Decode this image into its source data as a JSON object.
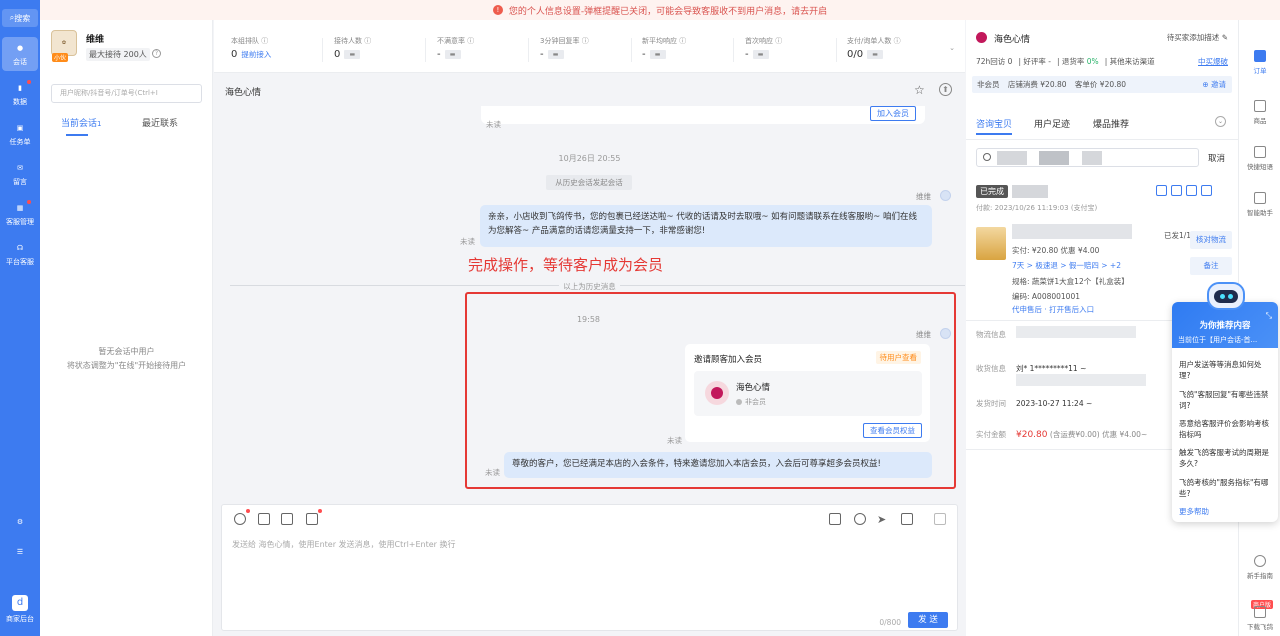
{
  "notice": {
    "text": "您的个人信息设置-弹框提醒已关闭，可能会导致客服收不到用户消息，请去开启"
  },
  "leftnav": {
    "search_label": "搜索",
    "items": [
      {
        "label": "会话",
        "icon": "chat-icon",
        "active": true
      },
      {
        "label": "数据",
        "icon": "chart-icon",
        "dot": true
      },
      {
        "label": "任务单",
        "icon": "task-icon"
      },
      {
        "label": "留言",
        "icon": "message-icon"
      },
      {
        "label": "客服管理",
        "icon": "manage-icon",
        "dot": true
      },
      {
        "label": "平台客服",
        "icon": "headset-icon"
      }
    ],
    "bottom_label": "商家后台"
  },
  "sessions": {
    "shop_name": "维维",
    "shop_badge": "小伙",
    "max_label": "最大接待 200人",
    "search_placeholder": "用户昵称/抖音号/订单号(Ctrl+I",
    "tabs": [
      "当前会话",
      "最近联系"
    ],
    "current_count": "1",
    "empty_line1": "暂无会话中用户",
    "empty_line2": "将状态调整为\"在线\"开始接待用户"
  },
  "stats": [
    {
      "label": "本组排队",
      "value": "0",
      "sub": "提前接入"
    },
    {
      "label": "接待人数",
      "value": "0"
    },
    {
      "label": "不满意率",
      "value": "-"
    },
    {
      "label": "3分钟回复率",
      "value": "-"
    },
    {
      "label": "新平均响应",
      "value": "-"
    },
    {
      "label": "首次响应",
      "value": "-"
    },
    {
      "label": "支付/询单人数",
      "value": "0/0"
    }
  ],
  "chat": {
    "title": "海色心情",
    "join_member_top": "加入会员",
    "unread": "未读",
    "time1": "10月26日 20:55",
    "history_start": "从历史会话发起会话",
    "sender": "维维",
    "msg1": "亲亲，小店收到飞鸽传书，您的包裹已经送达啦~ 代收的话请及时去取哦~ 如有问题请联系在线客服哟~ 咱们在线为您解答~ 产品满意的话请您满量支持一下，非常感谢您!",
    "annotation": "完成操作，等待客户成为会员",
    "history_above": "以上为历史消息",
    "time2": "19:58",
    "invite_title": "邀请顾客加入会员",
    "invite_status": "待用户查看",
    "member_name": "海色心情",
    "member_type": "非会员",
    "view_button": "查看会员权益",
    "msg2": "尊敬的客户，您已经满足本店的入会条件，特来邀请您加入本店会员，入会后可尊享超多会员权益!"
  },
  "input": {
    "placeholder": "发送给 海色心情，使用Enter 发送消息，使用Ctrl+Enter 换行",
    "counter": "0/800",
    "send": "发 送"
  },
  "customer": {
    "name": "海色心情",
    "remark": "待买家添加描述",
    "stat_return": "72h回访 0",
    "stat_good": "好评率 -",
    "stat_refund_label": "退货率",
    "stat_refund_val": "0%",
    "stat_other": "其他来访渠道",
    "link": "中买爆破",
    "chip_member": "非会员",
    "chip_spend": "店铺消费 ¥20.80",
    "chip_orders": "客单价 ¥20.80",
    "invite": "⊕ 邀请",
    "tabs": [
      "咨询宝贝",
      "用户足迹",
      "爆品推荐"
    ],
    "cancel": "取消",
    "order_status": "已完成",
    "order_time": "付款: 2023/10/26 11:19:03 (支付宝)",
    "prod_count": "已发1/1",
    "prod_price": "实付: ¥20.80 优惠 ¥4.00",
    "prod_tags": "7天 > 极速退 > 假一赔四 > +2",
    "prod_spec": "规格: 蔬菜饼1大盒12个【礼盒装】",
    "prod_code": "编码: A008001001",
    "prod_links": "代申售后 · 打开售后入口",
    "btn_check": "核对物流",
    "btn_remark": "备注",
    "logistics_label": "物流信息",
    "address_label": "收货信息",
    "address_val": "刘* 1*********11 ~",
    "ship_label": "发货时间",
    "ship_val": "2023-10-27 11:24 ~",
    "paid_label": "实付金额",
    "paid_val": "¥20.80",
    "paid_detail": "(含运费¥0.00)  优惠 ¥4.00~"
  },
  "rail": [
    {
      "label": "订单",
      "active": true
    },
    {
      "label": "商品"
    },
    {
      "label": "快捷短语"
    },
    {
      "label": "智能助手"
    },
    {
      "label": "新手指南"
    },
    {
      "label": "下载飞鸽"
    }
  ],
  "rail_badge": "商户版",
  "assistant": {
    "title": "为你推荐内容",
    "subtitle": "当前位于【用户会话-首...",
    "questions": [
      "用户发送等等消息如何处理?",
      "飞鸽\"客服回复\"有哪些违禁词?",
      "恶意给客服评价会影响考核指标吗",
      "触发飞鸽客服考试的周期是多久?",
      "飞鸽考核的\"服务指标\"有哪些?"
    ],
    "more": "更多帮助"
  },
  "colors": {
    "brand": "#3d7bf0",
    "annotation": "#e53935"
  }
}
